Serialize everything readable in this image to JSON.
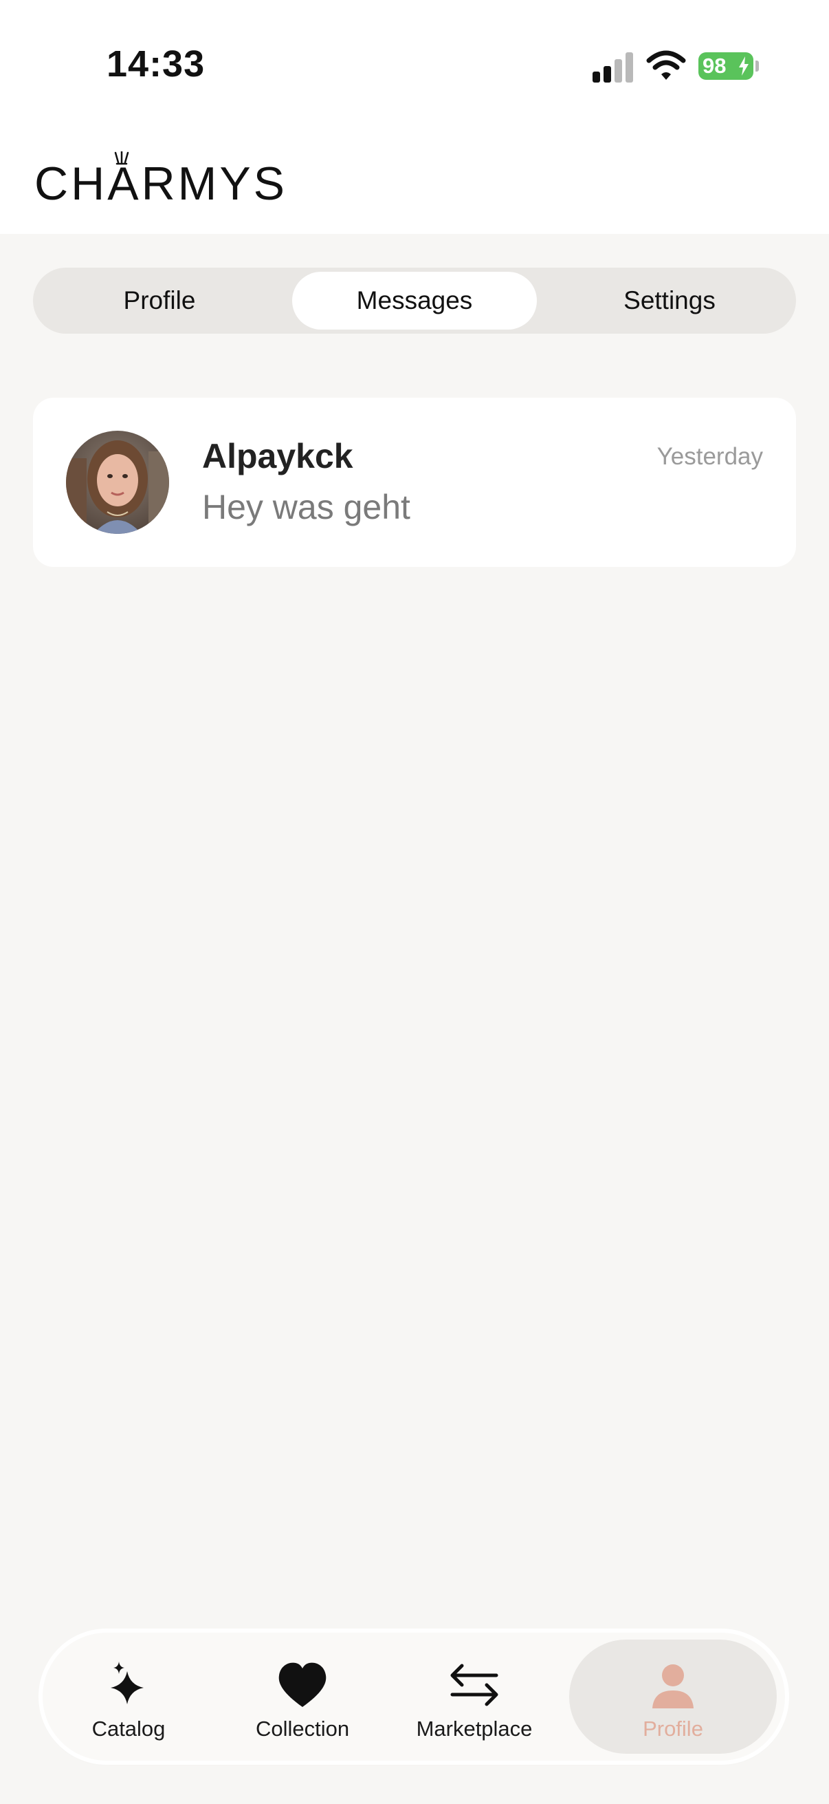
{
  "status_bar": {
    "time": "14:33",
    "battery": "98"
  },
  "header": {
    "logo": "CHARMYS"
  },
  "tabs": [
    {
      "label": "Profile",
      "active": false
    },
    {
      "label": "Messages",
      "active": true
    },
    {
      "label": "Settings",
      "active": false
    }
  ],
  "messages": [
    {
      "name": "Alpaykck",
      "preview": "Hey was geht",
      "time": "Yesterday",
      "avatar_icon": "user-avatar-photo"
    }
  ],
  "bottom_nav": [
    {
      "label": "Catalog",
      "icon": "sparkle-icon",
      "active": false
    },
    {
      "label": "Collection",
      "icon": "heart-icon",
      "active": false
    },
    {
      "label": "Marketplace",
      "icon": "swap-arrows-icon",
      "active": false
    },
    {
      "label": "Profile",
      "icon": "person-icon",
      "active": true
    }
  ],
  "colors": {
    "accent_profile": "#e2ae9d",
    "battery_green": "#5ac35b",
    "background": "#f7f6f4"
  }
}
